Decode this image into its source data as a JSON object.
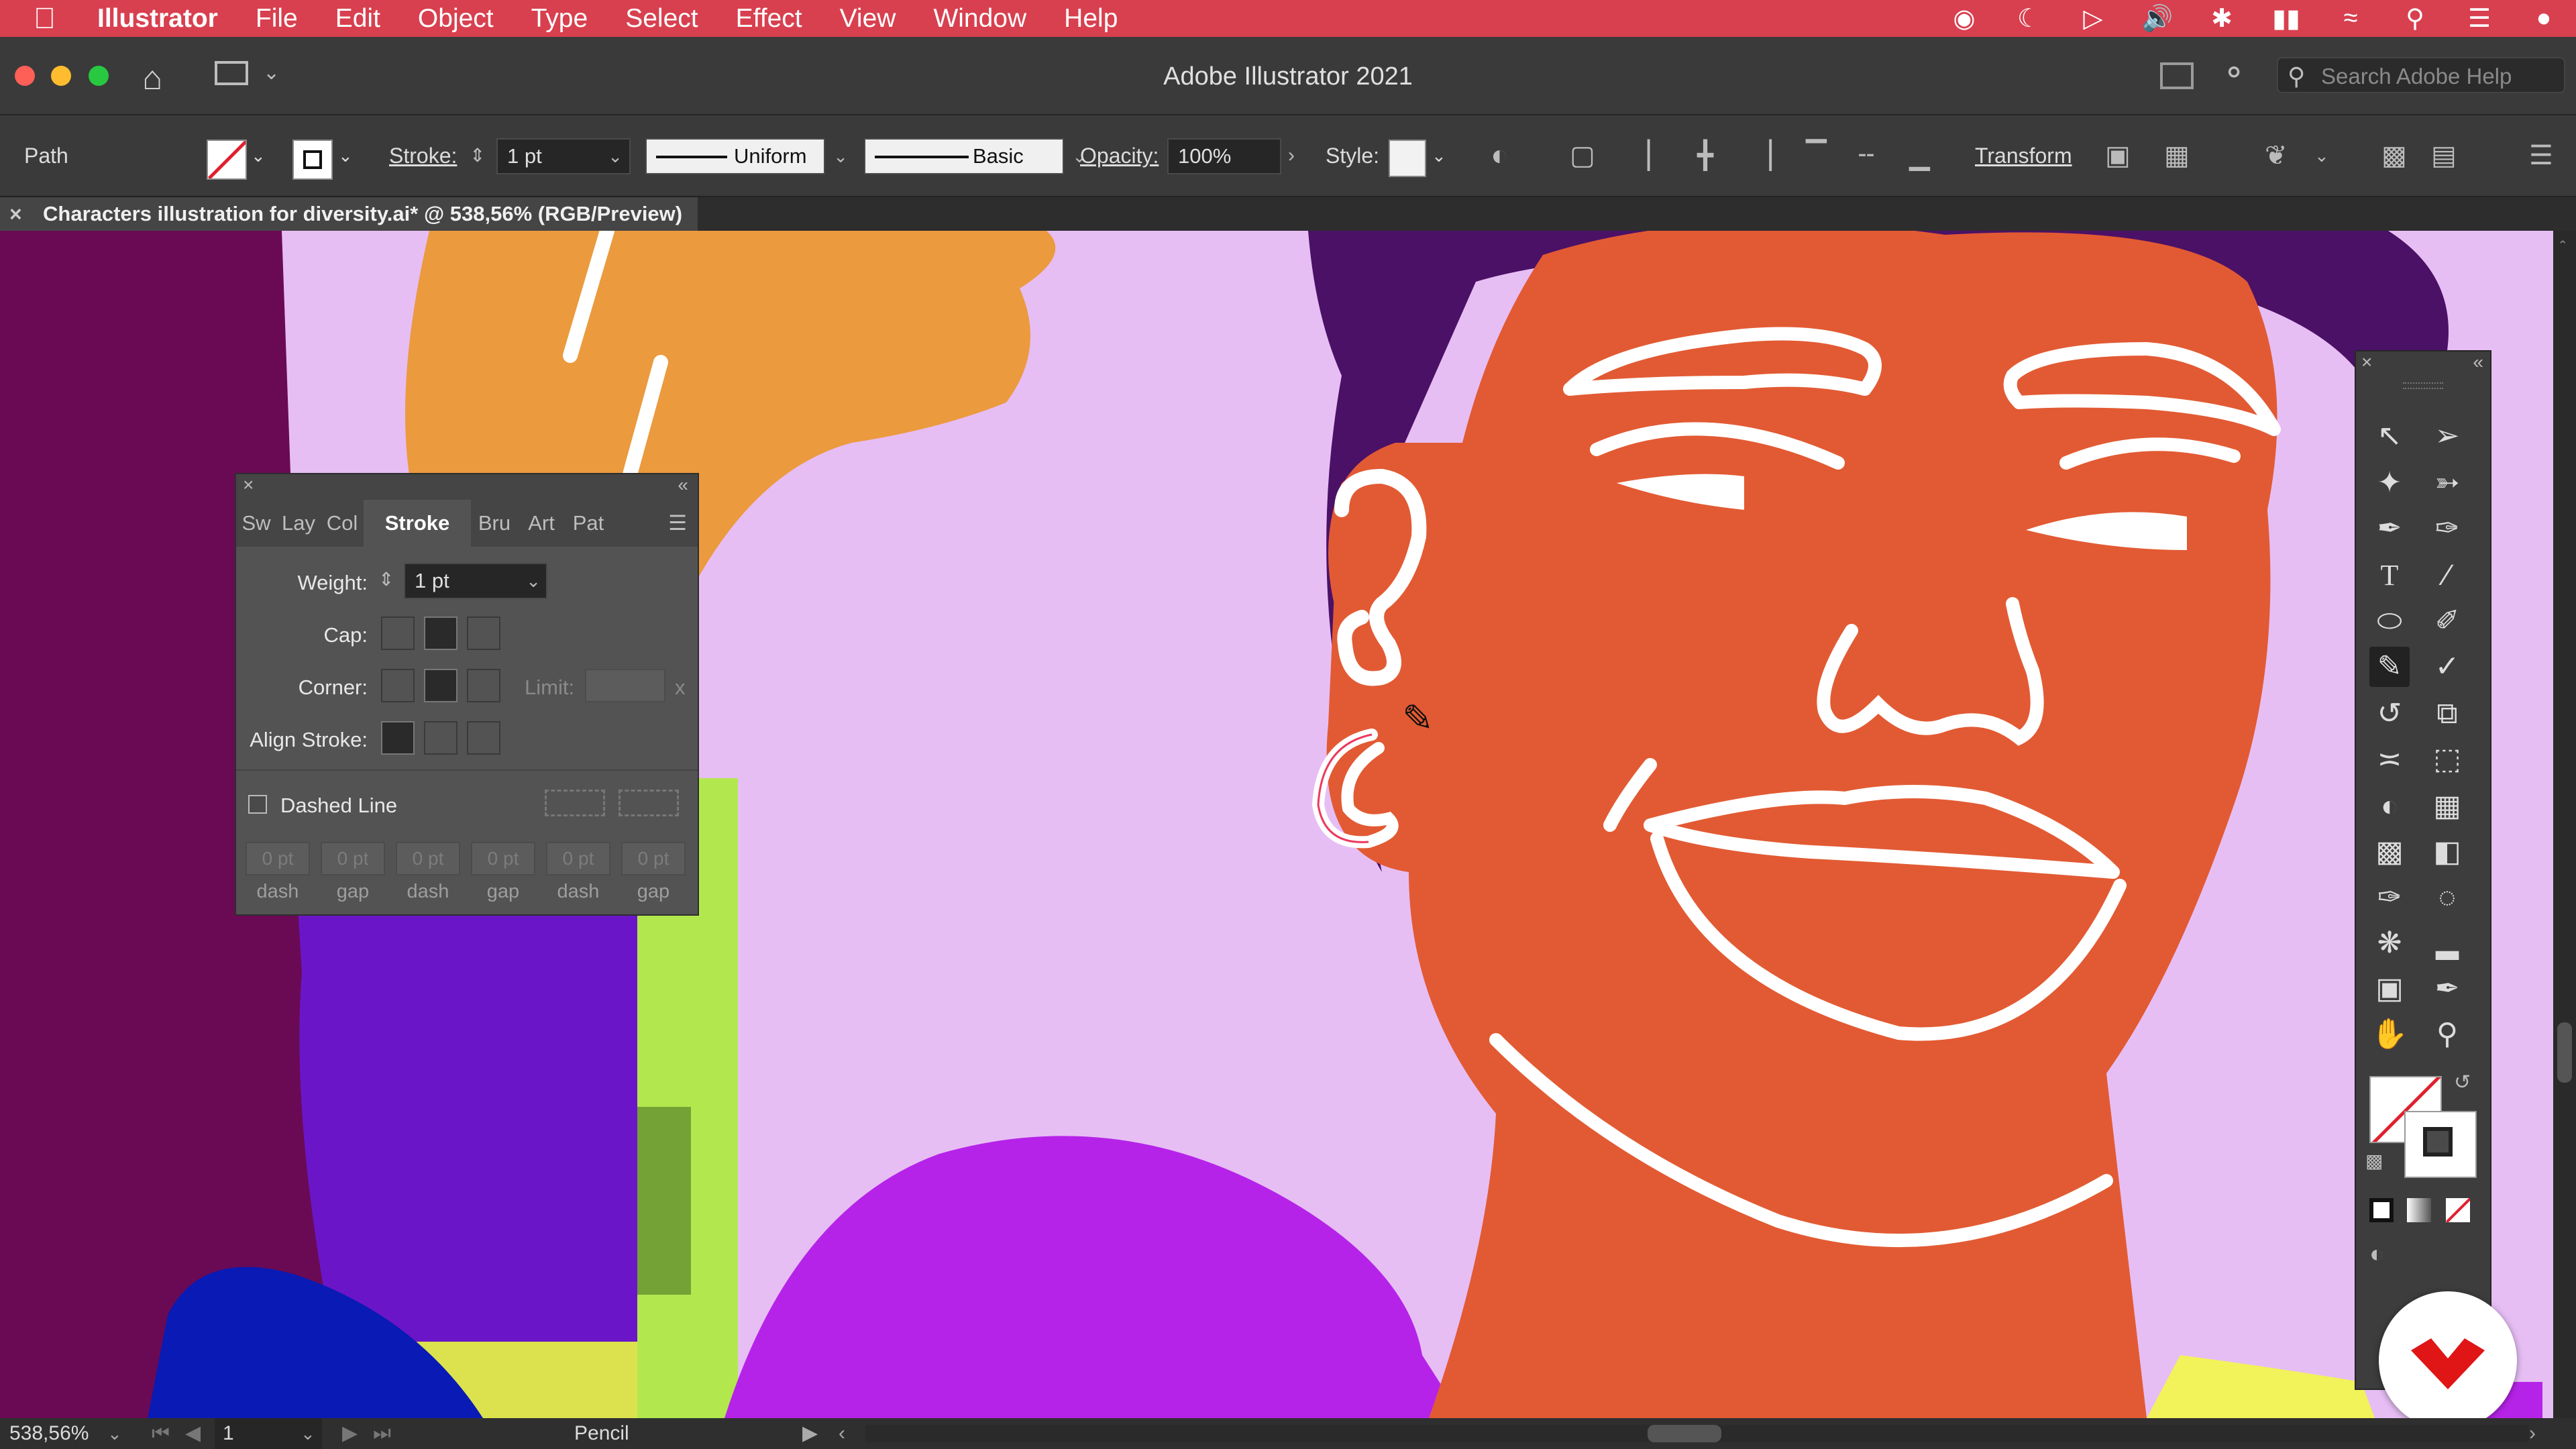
{
  "menubar": {
    "app_name": "Illustrator",
    "items": [
      "File",
      "Edit",
      "Object",
      "Type",
      "Select",
      "Effect",
      "View",
      "Window",
      "Help"
    ],
    "status_icons": [
      "creative-cloud-icon",
      "moon-icon",
      "play-icon",
      "volume-icon",
      "bluetooth-icon",
      "battery-icon",
      "wifi-icon",
      "spotlight-icon",
      "control-center-icon",
      "siri-icon"
    ]
  },
  "titlebar": {
    "title": "Adobe Illustrator 2021",
    "search_placeholder": "Search Adobe Help"
  },
  "controlbar": {
    "selection_type": "Path",
    "stroke_label": "Stroke:",
    "stroke_weight": "1 pt",
    "profile": "Uniform",
    "brush": "Basic",
    "opacity_label": "Opacity:",
    "opacity_value": "100%",
    "style_label": "Style:",
    "transform_label": "Transform"
  },
  "document": {
    "tab_title": "Characters illustration for diversity.ai* @ 538,56% (RGB/Preview)"
  },
  "stroke_panel": {
    "tabs": [
      "Sw",
      "Lay",
      "Col",
      "Stroke",
      "Bru",
      "Art",
      "Pat"
    ],
    "active_tab": "Stroke",
    "weight_label": "Weight:",
    "weight_value": "1 pt",
    "cap_label": "Cap:",
    "corner_label": "Corner:",
    "limit_label": "Limit:",
    "limit_close": "x",
    "align_label": "Align Stroke:",
    "dashed_label": "Dashed Line",
    "dash_values": [
      "0 pt",
      "0 pt",
      "0 pt",
      "0 pt",
      "0 pt",
      "0 pt"
    ],
    "dash_labels": [
      "dash",
      "gap",
      "dash",
      "gap",
      "dash",
      "gap"
    ]
  },
  "statusbar": {
    "zoom": "538,56%",
    "artboard": "1",
    "tool": "Pencil"
  },
  "colors": {
    "menubar": "#d8404f",
    "skin": "#e25a33",
    "background_lilac": "#e6bef4",
    "hair": "#4b1166",
    "shirt": "#b623e8",
    "hand": "#eb9a3e"
  }
}
